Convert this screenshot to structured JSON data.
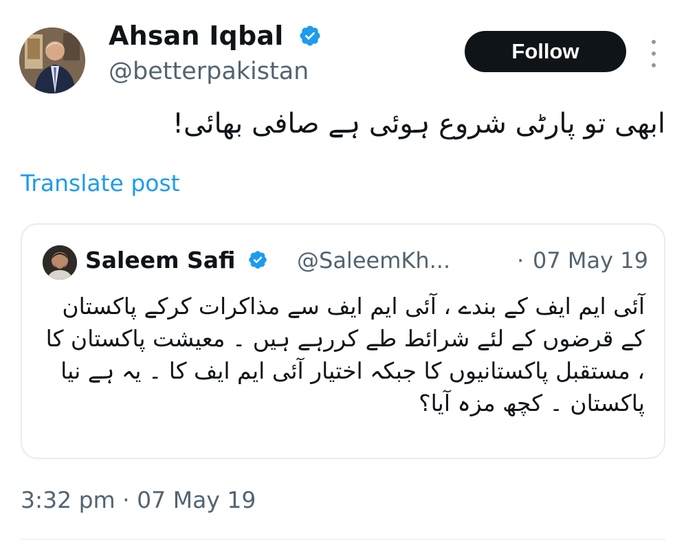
{
  "author": {
    "display_name": "Ahsan Iqbal",
    "handle": "@betterpakistan",
    "verified": true
  },
  "actions": {
    "follow_label": "Follow",
    "more_icon": "more-vertical-icon"
  },
  "post": {
    "text": "ابھی تو پارٹی شروع ہوئی ہے صافی بھائی!",
    "translate_label": "Translate post",
    "timestamp": "3:32 pm · 07 May 19"
  },
  "quote": {
    "display_name": "Saleem Safi",
    "handle": "@SaleemKh...",
    "separator": "·",
    "date": "07 May 19",
    "text": "آئی ایم ایف کے بندے ، آئی ایم ایف سے مذاکرات کرکے پاکستان کے قرضوں کے لئے شرائط طے کررہے ہیں ۔ معیشت پاکستان کا ، مستقبل پاکستانیوں کا جبکہ اختیار آئی ایم ایف کا ۔ یہ ہے نیا پاکستان ۔ کچھ مزہ آیا؟"
  },
  "colors": {
    "verified_badge": "#1d9bf0",
    "link": "#1d9bf0",
    "follow_bg": "#0f1419",
    "muted_text": "#536471"
  }
}
